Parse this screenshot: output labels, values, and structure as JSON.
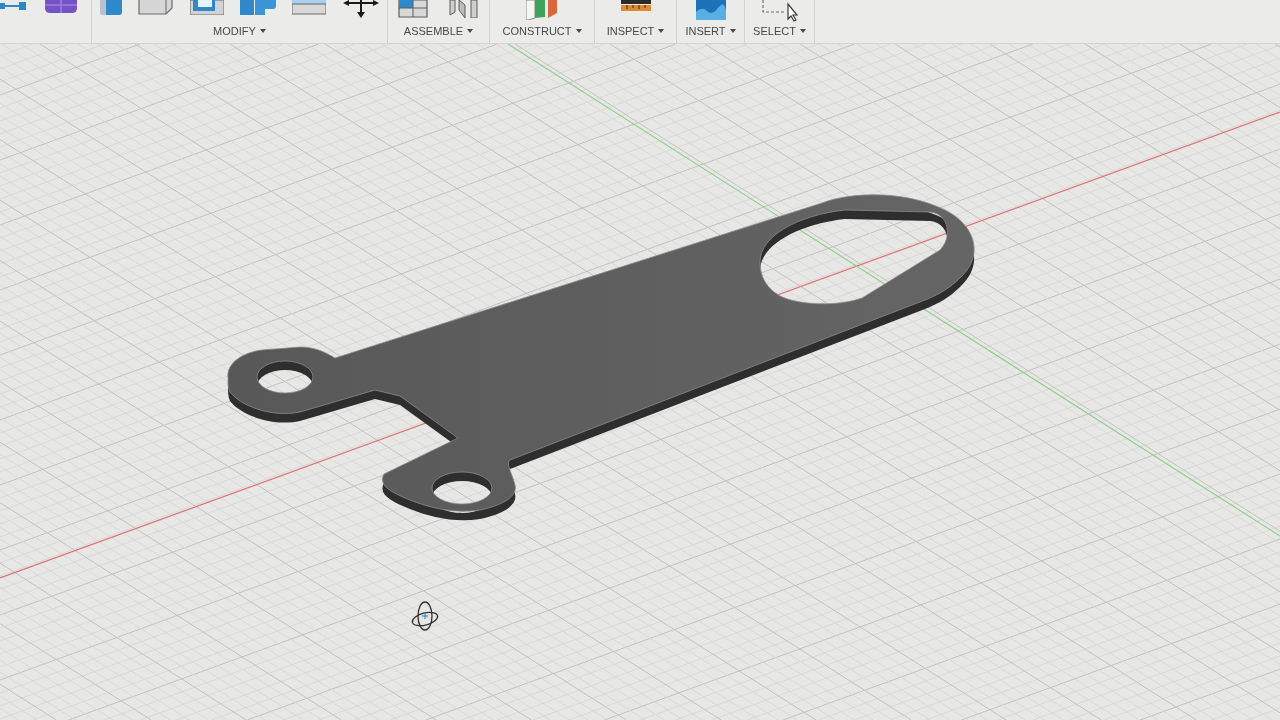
{
  "toolbar": {
    "groups": [
      {
        "kind": "create"
      },
      {
        "kind": "modify",
        "label": "MODIFY"
      },
      {
        "kind": "assemble",
        "label": "ASSEMBLE"
      },
      {
        "kind": "construct",
        "label": "CONSTRUCT"
      },
      {
        "kind": "inspect",
        "label": "INSPECT"
      },
      {
        "kind": "insert",
        "label": "INSERT"
      },
      {
        "kind": "select",
        "label": "SELECT"
      }
    ]
  }
}
